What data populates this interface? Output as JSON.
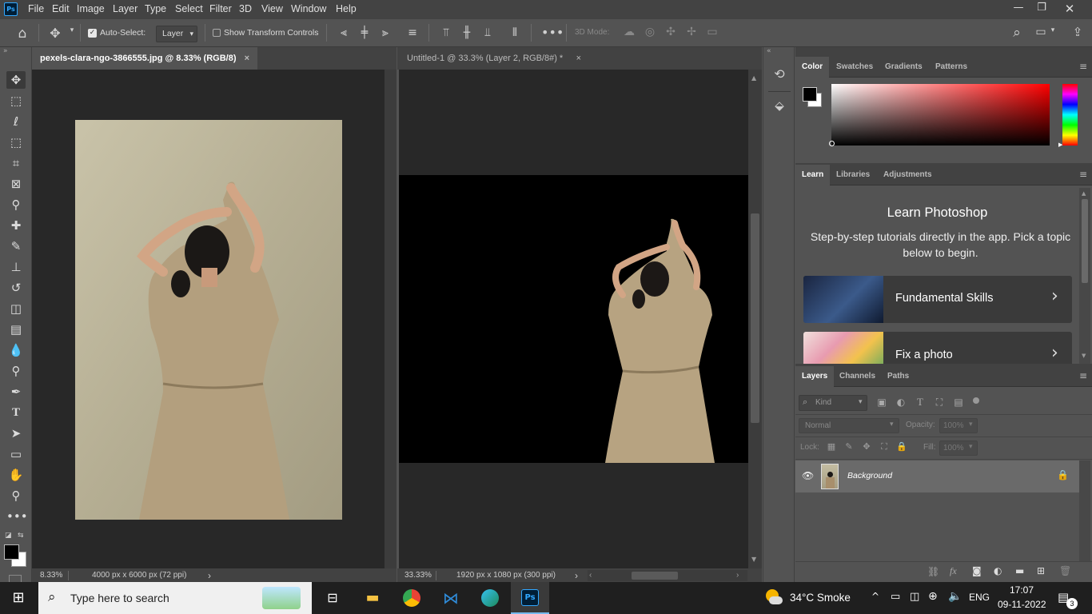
{
  "menu": {
    "app_logo": "Ps",
    "items": [
      "File",
      "Edit",
      "Image",
      "Layer",
      "Type",
      "Select",
      "Filter",
      "3D",
      "View",
      "Window",
      "Help"
    ]
  },
  "options": {
    "auto_select_label": "Auto-Select:",
    "auto_select_value": "Layer",
    "show_transform_label": "Show Transform Controls",
    "mode_3d_label": "3D Mode:"
  },
  "doc1": {
    "tab_title": "pexels-clara-ngo-3866555.jpg @ 8.33% (RGB/8)",
    "zoom": "8.33%",
    "size_info": "4000 px x 6000 px (72 ppi)"
  },
  "doc2": {
    "tab_title": "Untitled-1 @ 33.3% (Layer 2, RGB/8#) *",
    "zoom": "33.33%",
    "size_info": "1920 px x 1080 px (300 ppi)"
  },
  "color_panel": {
    "tabs": [
      "Color",
      "Swatches",
      "Gradients",
      "Patterns"
    ]
  },
  "learn_panel": {
    "tabs": [
      "Learn",
      "Libraries",
      "Adjustments"
    ],
    "title": "Learn Photoshop",
    "subtitle": "Step-by-step tutorials directly in the app. Pick a topic below to begin.",
    "cards": [
      "Fundamental Skills",
      "Fix a photo"
    ]
  },
  "layers_panel": {
    "tabs": [
      "Layers",
      "Channels",
      "Paths"
    ],
    "filter_placeholder": "Kind",
    "blend_mode": "Normal",
    "opacity_label": "Opacity:",
    "opacity_value": "100%",
    "lock_label": "Lock:",
    "fill_label": "Fill:",
    "fill_value": "100%",
    "layer_name": "Background"
  },
  "taskbar": {
    "search_placeholder": "Type here to search",
    "weather": "34°C  Smoke",
    "language": "ENG",
    "time": "17:07",
    "date": "09-11-2022",
    "notifications": "3"
  },
  "colors": {
    "ps_blue": "#31a8ff",
    "panel_bg": "#535353",
    "canvas_bg": "#282828",
    "fg_color": "#000000",
    "bg_color": "#ffffff"
  }
}
